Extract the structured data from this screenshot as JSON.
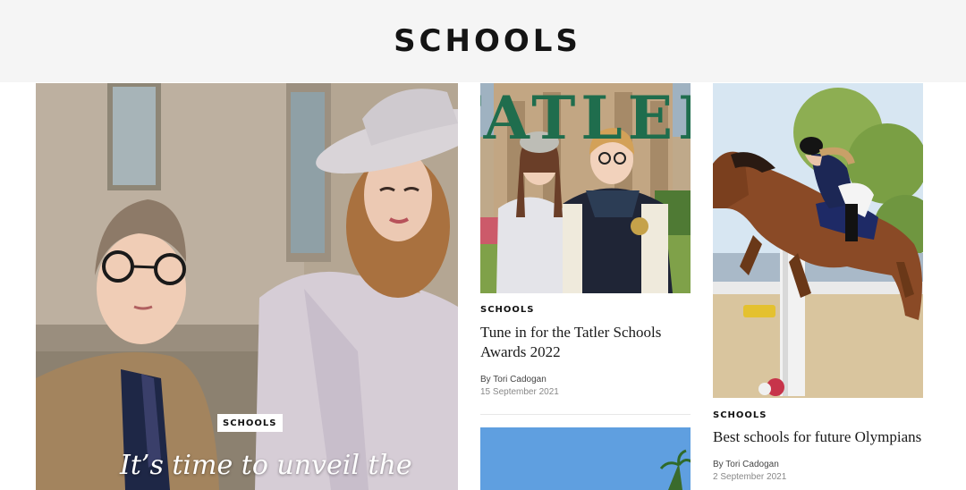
{
  "header": {
    "title": "SCHOOLS"
  },
  "hero": {
    "tag": "SCHOOLS",
    "title": "It’s time to unveil the"
  },
  "cards": [
    {
      "tag": "SCHOOLS",
      "title": "Tune in for the Tatler Schools Awards 2022",
      "author": "By Tori Cadogan",
      "date": "15 September 2021",
      "image_wordmark": "TATLER"
    },
    {
      "tag": "SCHOOLS",
      "title": "Best schools for future Olympians",
      "author": "By Tori Cadogan",
      "date": "2 September 2021"
    }
  ]
}
